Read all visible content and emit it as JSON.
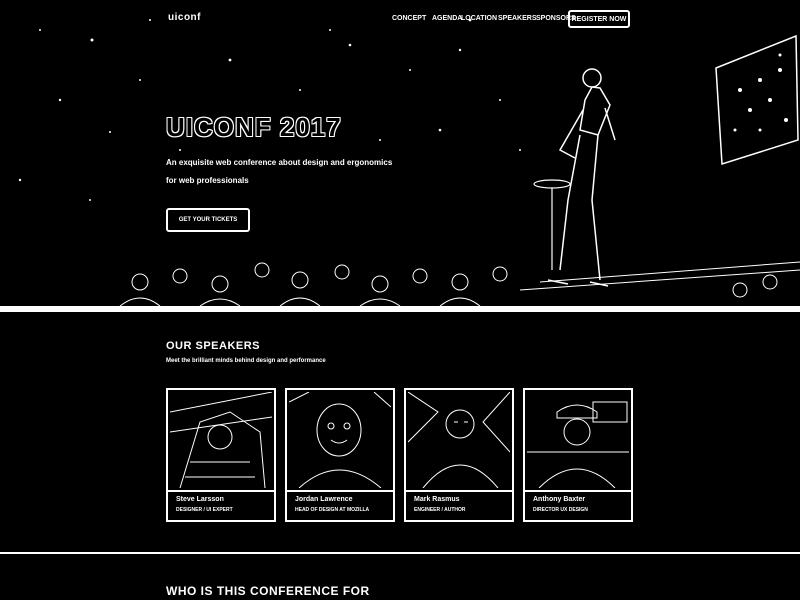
{
  "nav": {
    "logo": "uiconf",
    "links": [
      "Concept",
      "Agenda",
      "Location",
      "Speakers",
      "Sponsors"
    ],
    "cta": "Register now"
  },
  "hero": {
    "title": "UICONF 2017",
    "subtitle_line1": "An exquisite web conference about design and ergonomics",
    "subtitle_line2": "for web professionals",
    "button": "Get your tickets"
  },
  "speakers": {
    "title": "Our speakers",
    "subtitle": "Meet the brilliant minds behind design and performance",
    "cards": [
      {
        "name": "Steve Larsson",
        "role": "Designer / UI Expert"
      },
      {
        "name": "Jordan Lawrence",
        "role": "Head of Design at Mozilla"
      },
      {
        "name": "Mark Rasmus",
        "role": "Engineer / Author"
      },
      {
        "name": "Anthony Baxter",
        "role": "Director UX Design"
      }
    ]
  },
  "who": {
    "title": "Who is this conference for"
  }
}
